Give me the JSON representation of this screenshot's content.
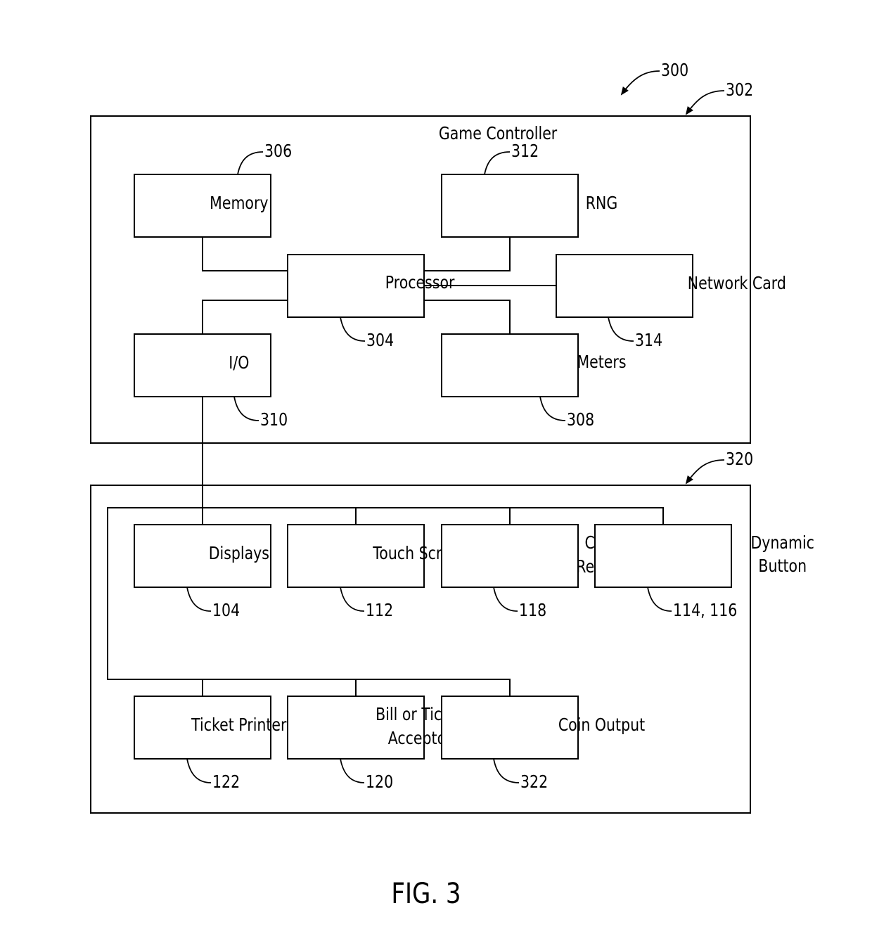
{
  "figure": {
    "caption": "FIG. 3",
    "ref_overall": "300"
  },
  "game_controller": {
    "title": "Game Controller",
    "ref": "302",
    "components": [
      {
        "id": "memory",
        "label": [
          "Memory"
        ],
        "ref": "306"
      },
      {
        "id": "rng",
        "label": [
          "RNG"
        ],
        "ref": "312"
      },
      {
        "id": "processor",
        "label": [
          "Processor"
        ],
        "ref": "304"
      },
      {
        "id": "network-card",
        "label": [
          "Network Card"
        ],
        "ref": "314"
      },
      {
        "id": "io",
        "label": [
          "I/O"
        ],
        "ref": "310"
      },
      {
        "id": "meters",
        "label": [
          "Meters"
        ],
        "ref": "308"
      }
    ]
  },
  "peripherals": {
    "ref": "320",
    "components": [
      {
        "id": "displays",
        "label": [
          "Displays"
        ],
        "ref": "104"
      },
      {
        "id": "touch-screen",
        "label": [
          "Touch Screen"
        ],
        "ref": "112"
      },
      {
        "id": "card-reader",
        "label": [
          "Card",
          "Reader"
        ],
        "ref": "118"
      },
      {
        "id": "dynamic-button",
        "label": [
          "Dynamic",
          "Button"
        ],
        "ref": "114, 116"
      },
      {
        "id": "ticket-printer",
        "label": [
          "Ticket Printer"
        ],
        "ref": "122"
      },
      {
        "id": "bill-or-ticket-acceptor",
        "label": [
          "Bill or Ticket",
          "Acceptor"
        ],
        "ref": "120"
      },
      {
        "id": "coin-output",
        "label": [
          "Coin Output"
        ],
        "ref": "322"
      }
    ]
  },
  "connections": [
    [
      "memory",
      "processor"
    ],
    [
      "rng",
      "processor"
    ],
    [
      "network-card",
      "processor"
    ],
    [
      "meters",
      "processor"
    ],
    [
      "io",
      "processor"
    ],
    [
      "io",
      "peripheral-bus"
    ],
    [
      "peripheral-bus",
      "displays"
    ],
    [
      "peripheral-bus",
      "touch-screen"
    ],
    [
      "peripheral-bus",
      "card-reader"
    ],
    [
      "peripheral-bus",
      "dynamic-button"
    ],
    [
      "peripheral-bus",
      "ticket-printer"
    ],
    [
      "peripheral-bus",
      "bill-or-ticket-acceptor"
    ],
    [
      "peripheral-bus",
      "coin-output"
    ]
  ]
}
